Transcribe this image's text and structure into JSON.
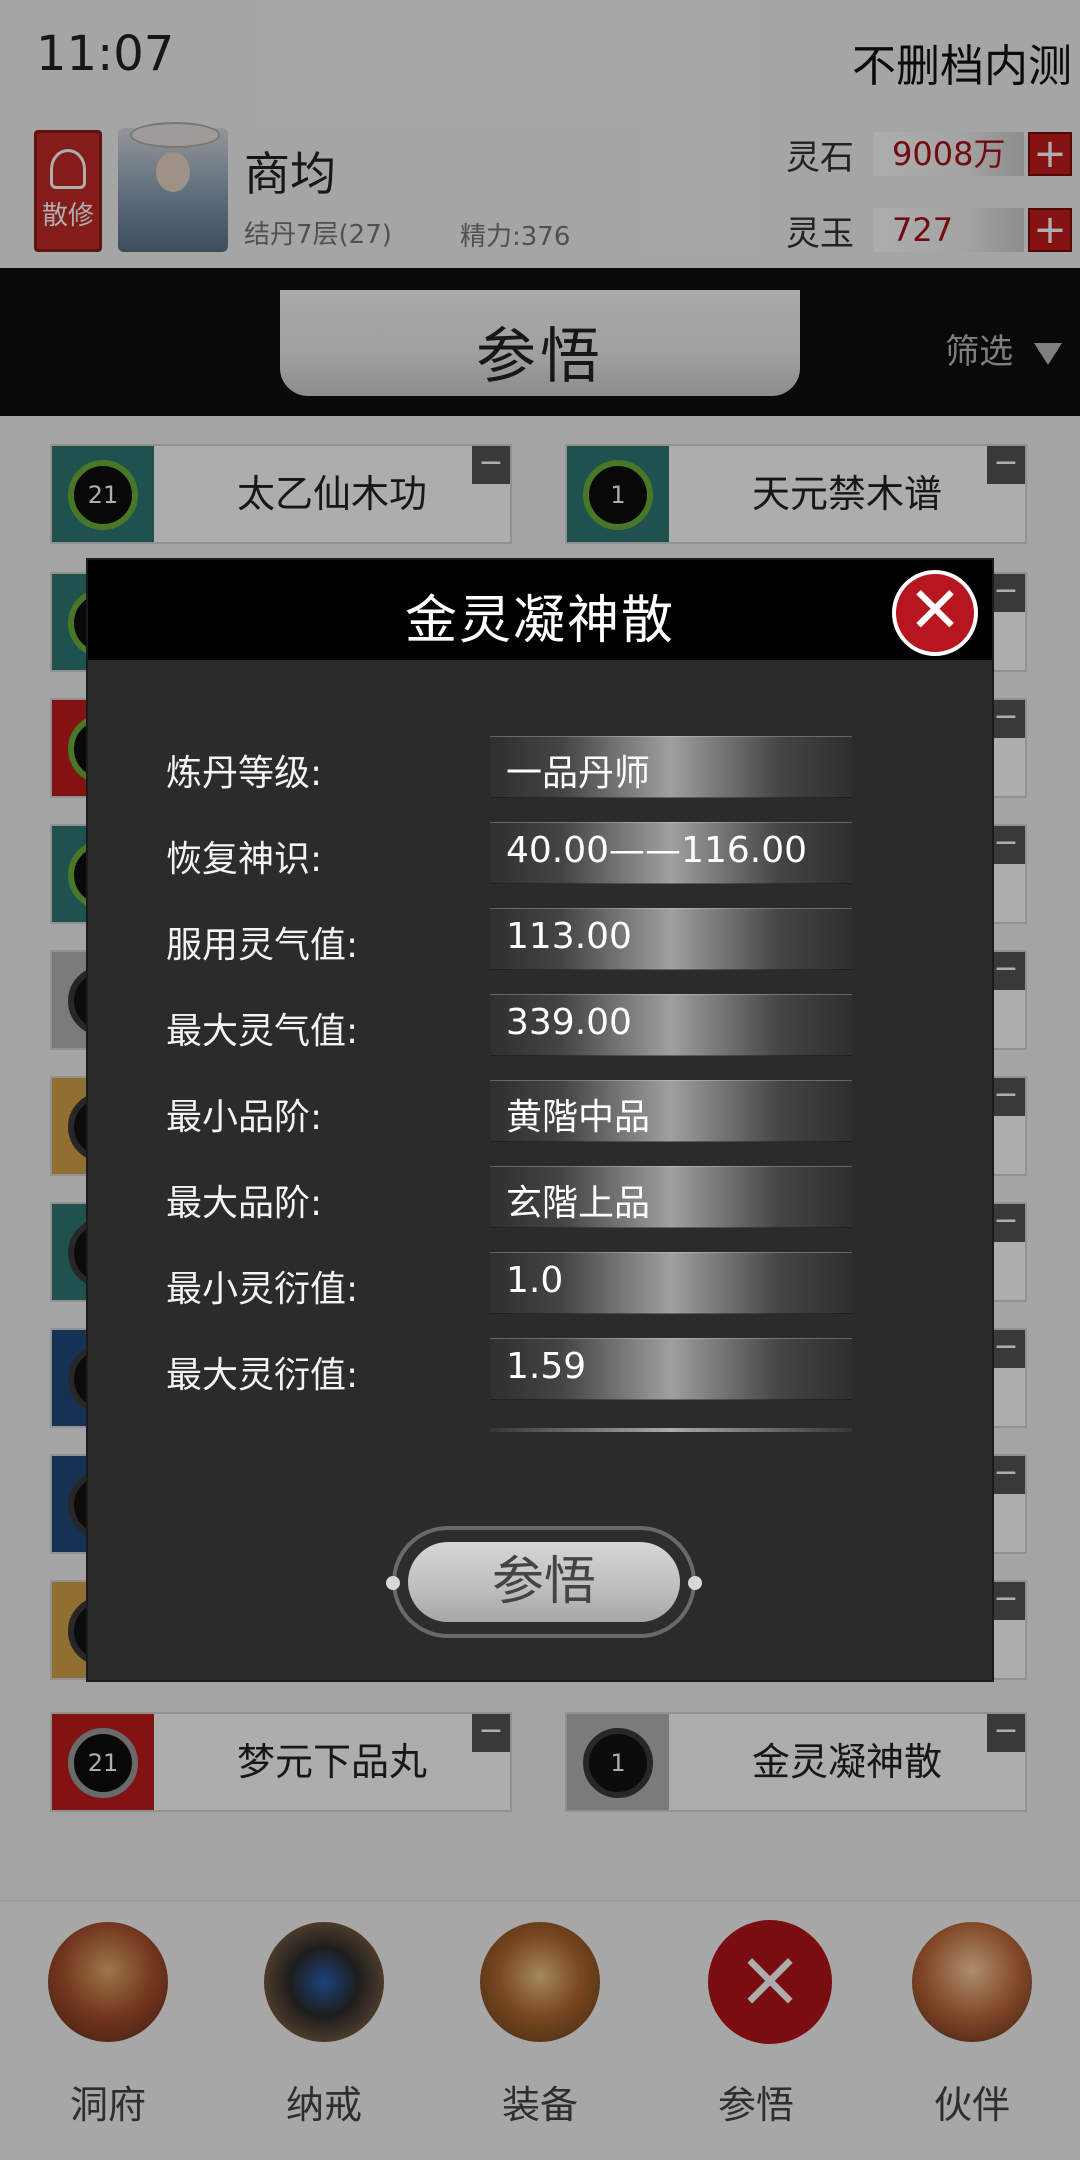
{
  "status": {
    "time": "11:07",
    "right_text": "不删档内测"
  },
  "header": {
    "sect_badge": "散修",
    "name": "商均",
    "realm": "结丹7层(27)",
    "energy": "精力:376",
    "resources": [
      {
        "label": "灵石",
        "value": "9008万"
      },
      {
        "label": "灵玉",
        "value": "727"
      }
    ]
  },
  "page": {
    "title": "参悟",
    "filter_label": "筛选"
  },
  "list": {
    "cards": [
      {
        "count": "21",
        "name": "太乙仙木功"
      },
      {
        "count": "1",
        "name": "天元禁木谱"
      },
      {
        "count": "21",
        "name": "梦元下品丸"
      },
      {
        "count": "1",
        "name": "金灵凝神散"
      }
    ]
  },
  "modal": {
    "title": "金灵凝神散",
    "stats": [
      {
        "label": "炼丹等级:",
        "value": "一品丹师"
      },
      {
        "label": "恢复神识:",
        "value": "40.00——116.00"
      },
      {
        "label": "服用灵气值:",
        "value": "113.00"
      },
      {
        "label": "最大灵气值:",
        "value": "339.00"
      },
      {
        "label": "最小品阶:",
        "value": "黄階中品"
      },
      {
        "label": "最大品阶:",
        "value": "玄階上品"
      },
      {
        "label": "最小灵衍值:",
        "value": "1.0"
      },
      {
        "label": "最大灵衍值:",
        "value": "1.59"
      }
    ],
    "button_label": "参悟"
  },
  "nav": {
    "items": [
      {
        "label": "洞府",
        "icon": "mansion-icon"
      },
      {
        "label": "纳戒",
        "icon": "ring-icon"
      },
      {
        "label": "装备",
        "icon": "equipment-icon"
      },
      {
        "label": "参悟",
        "icon": "close-icon"
      },
      {
        "label": "伙伴",
        "icon": "partner-icon"
      }
    ]
  }
}
